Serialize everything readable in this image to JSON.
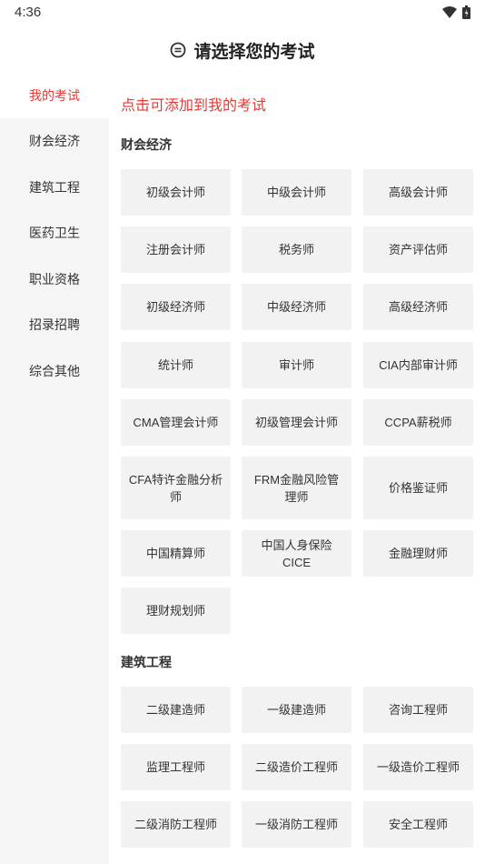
{
  "status_bar": {
    "time": "4:36"
  },
  "header": {
    "title": "请选择您的考试"
  },
  "sidebar": {
    "items": [
      {
        "label": "我的考试",
        "active": true
      },
      {
        "label": "财会经济"
      },
      {
        "label": "建筑工程"
      },
      {
        "label": "医药卫生"
      },
      {
        "label": "职业资格"
      },
      {
        "label": "招录招聘"
      },
      {
        "label": "综合其他"
      }
    ]
  },
  "main": {
    "hint": "点击可添加到我的考试",
    "sections": [
      {
        "title": "财会经济",
        "items": [
          "初级会计师",
          "中级会计师",
          "高级会计师",
          "注册会计师",
          "税务师",
          "资产评估师",
          "初级经济师",
          "中级经济师",
          "高级经济师",
          "统计师",
          "审计师",
          "CIA内部审计师",
          "CMA管理会计师",
          "初级管理会计师",
          "CCPA薪税师",
          "CFA特许金融分析师",
          "FRM金融风险管理师",
          "价格鉴证师",
          "中国精算师",
          "中国人身保险CICE",
          "金融理财师",
          "理财规划师"
        ]
      },
      {
        "title": "建筑工程",
        "items": [
          "二级建造师",
          "一级建造师",
          "咨询工程师",
          "监理工程师",
          "二级造价工程师",
          "一级造价工程师",
          "二级消防工程师",
          "一级消防工程师",
          "安全工程师"
        ]
      }
    ]
  },
  "colors": {
    "accent": "#e53935",
    "sidebar_bg": "#f5f5f5",
    "button_bg": "#f2f2f2"
  }
}
